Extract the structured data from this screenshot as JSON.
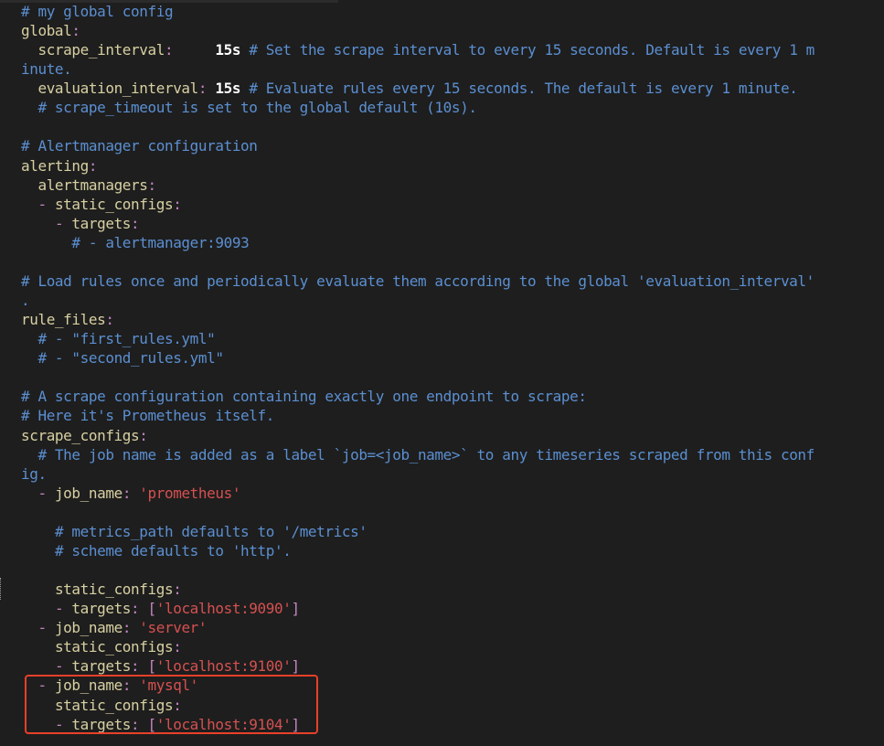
{
  "editor": {
    "colors": {
      "background": "#1e1e1e",
      "comment": "#5b8fd1",
      "key": "#d8d0a2",
      "string": "#d65050",
      "punct": "#c586c0",
      "highlight": "#e8402a"
    },
    "lines": [
      [
        [
          "c",
          "# my global config"
        ]
      ],
      [
        [
          "k",
          "global"
        ],
        [
          "pn",
          ":"
        ]
      ],
      [
        [
          "p",
          "  "
        ],
        [
          "k",
          "scrape_interval"
        ],
        [
          "pn",
          ":"
        ],
        [
          "p",
          "     "
        ],
        [
          "b",
          "15s"
        ],
        [
          "p",
          " "
        ],
        [
          "c",
          "# Set the scrape interval to every 15 seconds. Default is every 1 m"
        ]
      ],
      [
        [
          "c",
          "inute."
        ]
      ],
      [
        [
          "p",
          "  "
        ],
        [
          "k",
          "evaluation_interval"
        ],
        [
          "pn",
          ":"
        ],
        [
          "p",
          " "
        ],
        [
          "b",
          "15s"
        ],
        [
          "p",
          " "
        ],
        [
          "c",
          "# Evaluate rules every 15 seconds. The default is every 1 minute."
        ]
      ],
      [
        [
          "p",
          "  "
        ],
        [
          "c",
          "# scrape_timeout is set to the global default (10s)."
        ]
      ],
      [],
      [
        [
          "c",
          "# Alertmanager configuration"
        ]
      ],
      [
        [
          "k",
          "alerting"
        ],
        [
          "pn",
          ":"
        ]
      ],
      [
        [
          "p",
          "  "
        ],
        [
          "k",
          "alertmanagers"
        ],
        [
          "pn",
          ":"
        ]
      ],
      [
        [
          "p",
          "  "
        ],
        [
          "pn",
          "-"
        ],
        [
          "p",
          " "
        ],
        [
          "k",
          "static_configs"
        ],
        [
          "pn",
          ":"
        ]
      ],
      [
        [
          "p",
          "    "
        ],
        [
          "pn",
          "-"
        ],
        [
          "p",
          " "
        ],
        [
          "k",
          "targets"
        ],
        [
          "pn",
          ":"
        ]
      ],
      [
        [
          "p",
          "      "
        ],
        [
          "c",
          "# - alertmanager:9093"
        ]
      ],
      [],
      [
        [
          "c",
          "# Load rules once and periodically evaluate them according to the global 'evaluation_interval'"
        ]
      ],
      [
        [
          "c",
          "."
        ]
      ],
      [
        [
          "k",
          "rule_files"
        ],
        [
          "pn",
          ":"
        ]
      ],
      [
        [
          "p",
          "  "
        ],
        [
          "c",
          "# - \"first_rules.yml\""
        ]
      ],
      [
        [
          "p",
          "  "
        ],
        [
          "c",
          "# - \"second_rules.yml\""
        ]
      ],
      [],
      [
        [
          "c",
          "# A scrape configuration containing exactly one endpoint to scrape:"
        ]
      ],
      [
        [
          "c",
          "# Here it's Prometheus itself."
        ]
      ],
      [
        [
          "k",
          "scrape_configs"
        ],
        [
          "pn",
          ":"
        ]
      ],
      [
        [
          "p",
          "  "
        ],
        [
          "c",
          "# The job name is added as a label `job=<job_name>` to any timeseries scraped from this conf"
        ]
      ],
      [
        [
          "c",
          "ig."
        ]
      ],
      [
        [
          "p",
          "  "
        ],
        [
          "pn",
          "-"
        ],
        [
          "p",
          " "
        ],
        [
          "k",
          "job_name"
        ],
        [
          "pn",
          ":"
        ],
        [
          "p",
          " "
        ],
        [
          "s",
          "'prometheus'"
        ]
      ],
      [],
      [
        [
          "p",
          "    "
        ],
        [
          "c",
          "# metrics_path defaults to '/metrics'"
        ]
      ],
      [
        [
          "p",
          "    "
        ],
        [
          "c",
          "# scheme defaults to 'http'."
        ]
      ],
      [],
      [
        [
          "p",
          "    "
        ],
        [
          "k",
          "static_configs"
        ],
        [
          "pn",
          ":"
        ]
      ],
      [
        [
          "p",
          "    "
        ],
        [
          "pn",
          "-"
        ],
        [
          "p",
          " "
        ],
        [
          "k",
          "targets"
        ],
        [
          "pn",
          ":"
        ],
        [
          "p",
          " "
        ],
        [
          "pn",
          "["
        ],
        [
          "s",
          "'localhost:9090'"
        ],
        [
          "pn",
          "]"
        ]
      ],
      [
        [
          "p",
          "  "
        ],
        [
          "pn",
          "-"
        ],
        [
          "p",
          " "
        ],
        [
          "k",
          "job_name"
        ],
        [
          "pn",
          ":"
        ],
        [
          "p",
          " "
        ],
        [
          "s",
          "'server'"
        ]
      ],
      [
        [
          "p",
          "    "
        ],
        [
          "k",
          "static_configs"
        ],
        [
          "pn",
          ":"
        ]
      ],
      [
        [
          "p",
          "    "
        ],
        [
          "pn",
          "-"
        ],
        [
          "p",
          " "
        ],
        [
          "k",
          "targets"
        ],
        [
          "pn",
          ":"
        ],
        [
          "p",
          " "
        ],
        [
          "pn",
          "["
        ],
        [
          "s",
          "'localhost:9100'"
        ],
        [
          "pn",
          "]"
        ]
      ],
      [
        [
          "p",
          "  "
        ],
        [
          "pn",
          "-"
        ],
        [
          "p",
          " "
        ],
        [
          "k",
          "job_name"
        ],
        [
          "pn",
          ":"
        ],
        [
          "p",
          " "
        ],
        [
          "s",
          "'mysql'"
        ]
      ],
      [
        [
          "p",
          "    "
        ],
        [
          "k",
          "static_configs"
        ],
        [
          "pn",
          ":"
        ]
      ],
      [
        [
          "p",
          "    "
        ],
        [
          "pn",
          "-"
        ],
        [
          "p",
          " "
        ],
        [
          "k",
          "targets"
        ],
        [
          "pn",
          ":"
        ],
        [
          "p",
          " "
        ],
        [
          "pn",
          "["
        ],
        [
          "s",
          "'localhost:9104'"
        ],
        [
          "pn",
          "]"
        ]
      ]
    ]
  }
}
